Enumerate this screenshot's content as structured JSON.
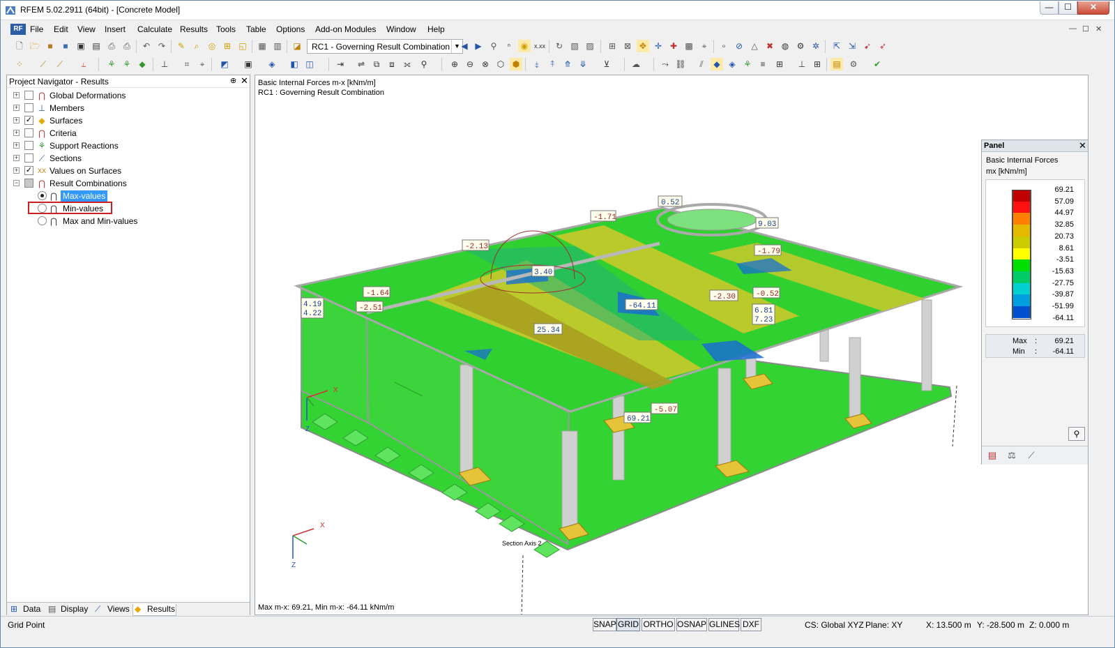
{
  "window": {
    "title": "RFEM 5.02.2911 (64bit) - [Concrete Model]",
    "minimize": "—",
    "maximize": "☐",
    "close": "✕"
  },
  "menu": {
    "items": [
      "File",
      "Edit",
      "View",
      "Insert",
      "Calculate",
      "Results",
      "Tools",
      "Table",
      "Options",
      "Add-on Modules",
      "Window",
      "Help"
    ],
    "doc_controls": [
      "—",
      "☐",
      "✕"
    ]
  },
  "toolbar": {
    "combo_value": "RC1 - Governing Result Combination"
  },
  "navigator": {
    "title": "Project Navigator - Results",
    "items": [
      {
        "label": "Global Deformations",
        "checked": false
      },
      {
        "label": "Members",
        "checked": false
      },
      {
        "label": "Surfaces",
        "checked": true
      },
      {
        "label": "Criteria",
        "checked": false
      },
      {
        "label": "Support Reactions",
        "checked": false
      },
      {
        "label": "Sections",
        "checked": false
      },
      {
        "label": "Values on Surfaces",
        "checked": true
      },
      {
        "label": "Result Combinations",
        "checked": "partial"
      }
    ],
    "sub_items": [
      {
        "label": "Max-values",
        "selected": true
      },
      {
        "label": "Min-values",
        "selected": false
      },
      {
        "label": "Max and Min-values",
        "selected": false
      }
    ],
    "tabs": [
      "Data",
      "Display",
      "Views",
      "Results"
    ],
    "active_tab": "Results"
  },
  "view": {
    "header_line1": "Basic Internal Forces m-x [kNm/m]",
    "header_line2": "RC1 : Governing Result Combination",
    "footer": "Max m-x: 69.21, Min m-x: -64.11 kNm/m",
    "section_label": "Section Axis 2",
    "axis_x": "X",
    "axis_z": "Z",
    "value_labels": [
      "0.52",
      "-1.71",
      "9.03",
      "-2.13",
      "-1.79",
      "3.40",
      "-1.64",
      "-0.52",
      "4.19",
      "4.22",
      "-2.51",
      "-64.11",
      "-2.30",
      "6.81",
      "7.23",
      "25.34",
      "-5.07",
      "69.21"
    ]
  },
  "panel": {
    "title": "Panel",
    "quantity": "Basic Internal Forces",
    "unit": "mx [kNm/m]",
    "legend": [
      {
        "value": "69.21",
        "color": "#c00000"
      },
      {
        "value": "57.09",
        "color": "#ff1010"
      },
      {
        "value": "44.97",
        "color": "#ff8000"
      },
      {
        "value": "32.85",
        "color": "#e6b800"
      },
      {
        "value": "20.73",
        "color": "#cccc00"
      },
      {
        "value": "8.61",
        "color": "#ffff00"
      },
      {
        "value": "-3.51",
        "color": "#00e000"
      },
      {
        "value": "-15.63",
        "color": "#00cc66"
      },
      {
        "value": "-27.75",
        "color": "#00d0d0"
      },
      {
        "value": "-39.87",
        "color": "#00a0e0"
      },
      {
        "value": "-51.99",
        "color": "#0050d0"
      },
      {
        "value": "-64.11",
        "color": "#0000a0"
      }
    ],
    "max_label": "Max",
    "min_label": "Min",
    "max_value": "69.21",
    "min_value": "-64.11",
    "sep": ":"
  },
  "status": {
    "left": "Grid Point",
    "toggles": [
      "SNAP",
      "GRID",
      "ORTHO",
      "OSNAP",
      "GLINES",
      "DXF"
    ],
    "active_toggle": "GRID",
    "cs": "CS: Global XYZ",
    "plane": "Plane: XY",
    "x": "X:  13.500 m",
    "y": "Y:  -28.500 m",
    "z": "Z:  0.000 m"
  }
}
